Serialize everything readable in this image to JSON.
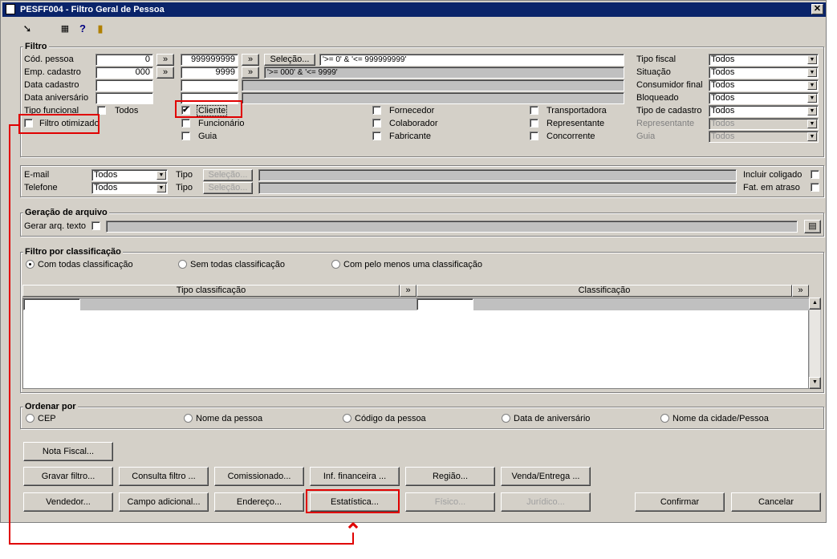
{
  "window": {
    "title": "PESFF004 - Filtro Geral de Pessoa",
    "close_label": "✕"
  },
  "toolbar": {
    "icons": [
      "exit-icon",
      "calculator-icon",
      "help-icon",
      "door-icon"
    ]
  },
  "filtro": {
    "title": "Filtro",
    "cod_pessoa": {
      "label": "Cód. pessoa",
      "from": "0",
      "to": "999999999",
      "range": "'>= 0' & '<= 999999999'"
    },
    "emp_cadastro": {
      "label": "Emp. cadastro",
      "from": "000",
      "to": "9999",
      "range": "'>= 000' & '<= 9999'"
    },
    "more_label": "»",
    "selecao_label": "Seleção...",
    "data_cadastro_label": "Data cadastro",
    "data_aniversario_label": "Data aniversário",
    "tipo_funcional_label": "Tipo funcional",
    "filtro_otimizado_label": "Filtro otimizado",
    "tipos": {
      "todos": "Todos",
      "cliente": "Cliente",
      "funcionario": "Funcionário",
      "guia": "Guia",
      "fornecedor": "Fornecedor",
      "colaborador": "Colaborador",
      "fabricante": "Fabricante",
      "transportadora": "Transportadora",
      "representante": "Representante",
      "concorrente": "Concorrente"
    },
    "check": "✔",
    "right": {
      "tipo_fiscal": {
        "label": "Tipo fiscal",
        "value": "Todos"
      },
      "situacao": {
        "label": "Situação",
        "value": "Todos"
      },
      "consumidor_final": {
        "label": "Consumidor final",
        "value": "Todos"
      },
      "bloqueado": {
        "label": "Bloqueado",
        "value": "Todos"
      },
      "tipo_cadastro": {
        "label": "Tipo de cadastro",
        "value": "Todos"
      },
      "representante": {
        "label": "Representante",
        "value": "Todos"
      },
      "guia": {
        "label": "Guia",
        "value": "Todos"
      }
    },
    "email": {
      "label": "E-mail",
      "value": "Todos"
    },
    "telefone": {
      "label": "Telefone",
      "value": "Todos"
    },
    "tipo_label": "Tipo",
    "incluir_coligado_label": "Incluir coligado",
    "fat_atraso_label": "Fat. em atraso"
  },
  "arquivo": {
    "title": "Geração de arquivo",
    "gerar_label": "Gerar arq. texto"
  },
  "classificacao": {
    "title": "Filtro por classificação",
    "options": [
      "Com todas classificação",
      "Sem todas classificação",
      "Com pelo menos uma classificação"
    ],
    "col_tipo": "Tipo classificação",
    "col_class": "Classificação"
  },
  "ordenar": {
    "title": "Ordenar por",
    "options": [
      "CEP",
      "Nome da pessoa",
      "Código da pessoa",
      "Data de aniversário",
      "Nome da cidade/Pessoa"
    ]
  },
  "buttons": {
    "nota_fiscal": "Nota Fiscal...",
    "gravar_filtro": "Gravar filtro...",
    "consulta_filtro": "Consulta filtro ...",
    "comissionado": "Comissionado...",
    "inf_financeira": "Inf. financeira ...",
    "regiao": "Região...",
    "venda_entrega": "Venda/Entrega ...",
    "vendedor": "Vendedor...",
    "campo_adicional": "Campo adicional...",
    "endereco": "Endereço...",
    "estatistica": "Estatística...",
    "fisico": "Físico...",
    "juridico": "Jurídico...",
    "confirmar": "Confirmar",
    "cancelar": "Cancelar"
  },
  "annotation": {
    "color": "#e00000",
    "arrow": "⌃"
  }
}
